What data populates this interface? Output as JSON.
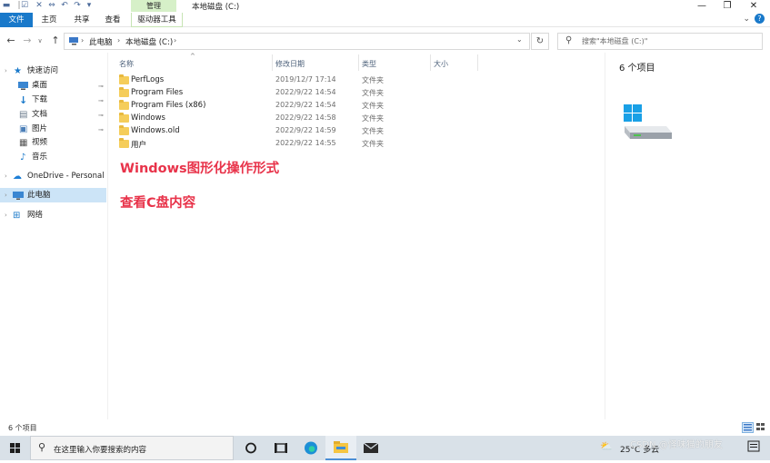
{
  "titlebar": {
    "context_tab": "管理",
    "window_title": "本地磁盘 (C:)",
    "minimize": "—",
    "maximize": "❐",
    "close": "✕"
  },
  "ribbon": {
    "tabs": [
      "文件",
      "主页",
      "共享",
      "查看"
    ],
    "context_tab": "驱动器工具",
    "help": "?"
  },
  "address": {
    "crumbs": [
      "此电脑",
      "本地磁盘 (C:)"
    ],
    "search_placeholder": "搜索\"本地磁盘 (C:)\""
  },
  "nav": {
    "quick_access": "快速访问",
    "items": [
      "桌面",
      "下载",
      "文档",
      "图片",
      "视频",
      "音乐"
    ],
    "onedrive": "OneDrive - Personal",
    "this_pc": "此电脑",
    "network": "网络"
  },
  "columns": [
    "名称",
    "修改日期",
    "类型",
    "大小"
  ],
  "files": [
    {
      "name": "PerfLogs",
      "date": "2019/12/7 17:14",
      "type": "文件夹"
    },
    {
      "name": "Program Files",
      "date": "2022/9/22 14:54",
      "type": "文件夹"
    },
    {
      "name": "Program Files (x86)",
      "date": "2022/9/22 14:54",
      "type": "文件夹"
    },
    {
      "name": "Windows",
      "date": "2022/9/22 14:58",
      "type": "文件夹"
    },
    {
      "name": "Windows.old",
      "date": "2022/9/22 14:59",
      "type": "文件夹"
    },
    {
      "name": "用户",
      "date": "2022/9/22 14:55",
      "type": "文件夹"
    }
  ],
  "annotations": [
    "Windows图形化操作形式",
    "查看C盘内容"
  ],
  "preview": {
    "count_text": "6 个项目"
  },
  "status": {
    "text": "6 个项目"
  },
  "taskbar": {
    "search_placeholder": "在这里输入你要搜索的内容",
    "weather": "25°C 多云",
    "watermark": "CSDN @怪味猫的朋友"
  },
  "colors": {
    "accent": "#1979ca",
    "annotation": "#e8334a",
    "context_tab": "#d6f0c8"
  }
}
